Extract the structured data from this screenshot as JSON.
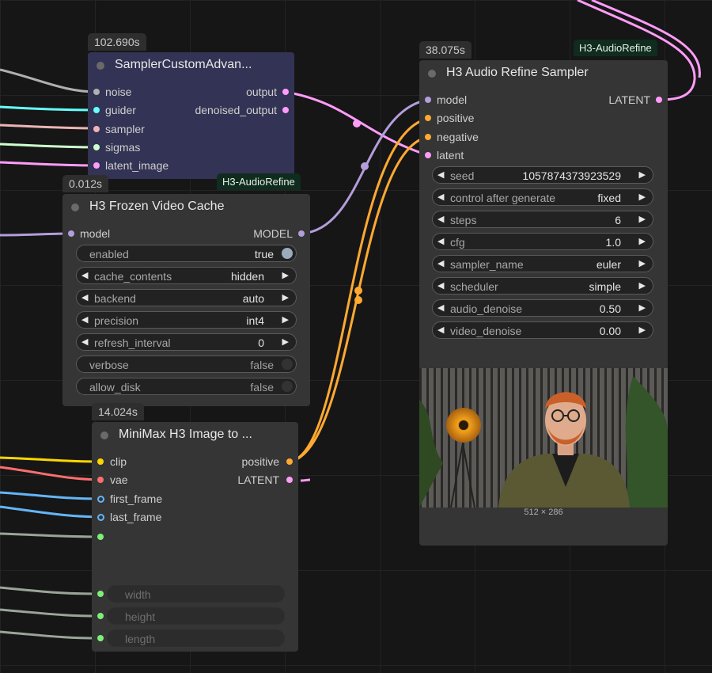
{
  "colors": {
    "model": "#b39ddb",
    "positive": "#ffa931",
    "negative": "#ffa931",
    "latent": "#ff9cf9",
    "latent_out": "#ff9cf9",
    "noise": "#b0b0b0",
    "guider": "#66ffff",
    "sampler": "#ecb4b4",
    "sigmas": "#cdffcd",
    "clip": "#ffd500",
    "vae": "#ff6e6e",
    "image": "#64b5f6",
    "int": "#7cf078",
    "wire_gray": "#9aa59a"
  },
  "nodes": {
    "sampler_custom": {
      "time": "102.690s",
      "title": "SamplerCustomAdvan...",
      "inputs": [
        "noise",
        "guider",
        "sampler",
        "sigmas",
        "latent_image"
      ],
      "outputs": [
        "output",
        "denoised_output"
      ]
    },
    "frozen_cache": {
      "time": "0.012s",
      "tag": "H3-AudioRefine",
      "title": "H3 Frozen Video Cache",
      "input": "model",
      "output": "MODEL",
      "widgets": [
        {
          "label": "enabled",
          "value": "true",
          "type": "toggle",
          "on": true
        },
        {
          "label": "cache_contents",
          "value": "hidden",
          "type": "combo"
        },
        {
          "label": "backend",
          "value": "auto",
          "type": "combo"
        },
        {
          "label": "precision",
          "value": "int4",
          "type": "combo"
        },
        {
          "label": "refresh_interval",
          "value": "0",
          "type": "number"
        },
        {
          "label": "verbose",
          "value": "false",
          "type": "toggle",
          "on": false
        },
        {
          "label": "allow_disk",
          "value": "false",
          "type": "toggle",
          "on": false
        }
      ]
    },
    "minimax": {
      "time": "14.024s",
      "title": "MiniMax H3 Image to ...",
      "inputs": [
        "clip",
        "vae",
        "first_frame",
        "last_frame",
        ""
      ],
      "outputs": [
        "positive",
        "LATENT"
      ],
      "widget_inputs": [
        "width",
        "height",
        "length"
      ]
    },
    "refine": {
      "time": "38.075s",
      "tag": "H3-AudioRefine",
      "title": "H3 Audio Refine Sampler",
      "inputs": [
        "model",
        "positive",
        "negative",
        "latent"
      ],
      "output": "LATENT",
      "widgets": [
        {
          "label": "seed",
          "value": "1057874373923529"
        },
        {
          "label": "control after generate",
          "value": "fixed"
        },
        {
          "label": "steps",
          "value": "6"
        },
        {
          "label": "cfg",
          "value": "1.0"
        },
        {
          "label": "sampler_name",
          "value": "euler"
        },
        {
          "label": "scheduler",
          "value": "simple"
        },
        {
          "label": "audio_denoise",
          "value": "0.50"
        },
        {
          "label": "video_denoise",
          "value": "0.00"
        }
      ],
      "preview_size": "512 × 286"
    }
  }
}
